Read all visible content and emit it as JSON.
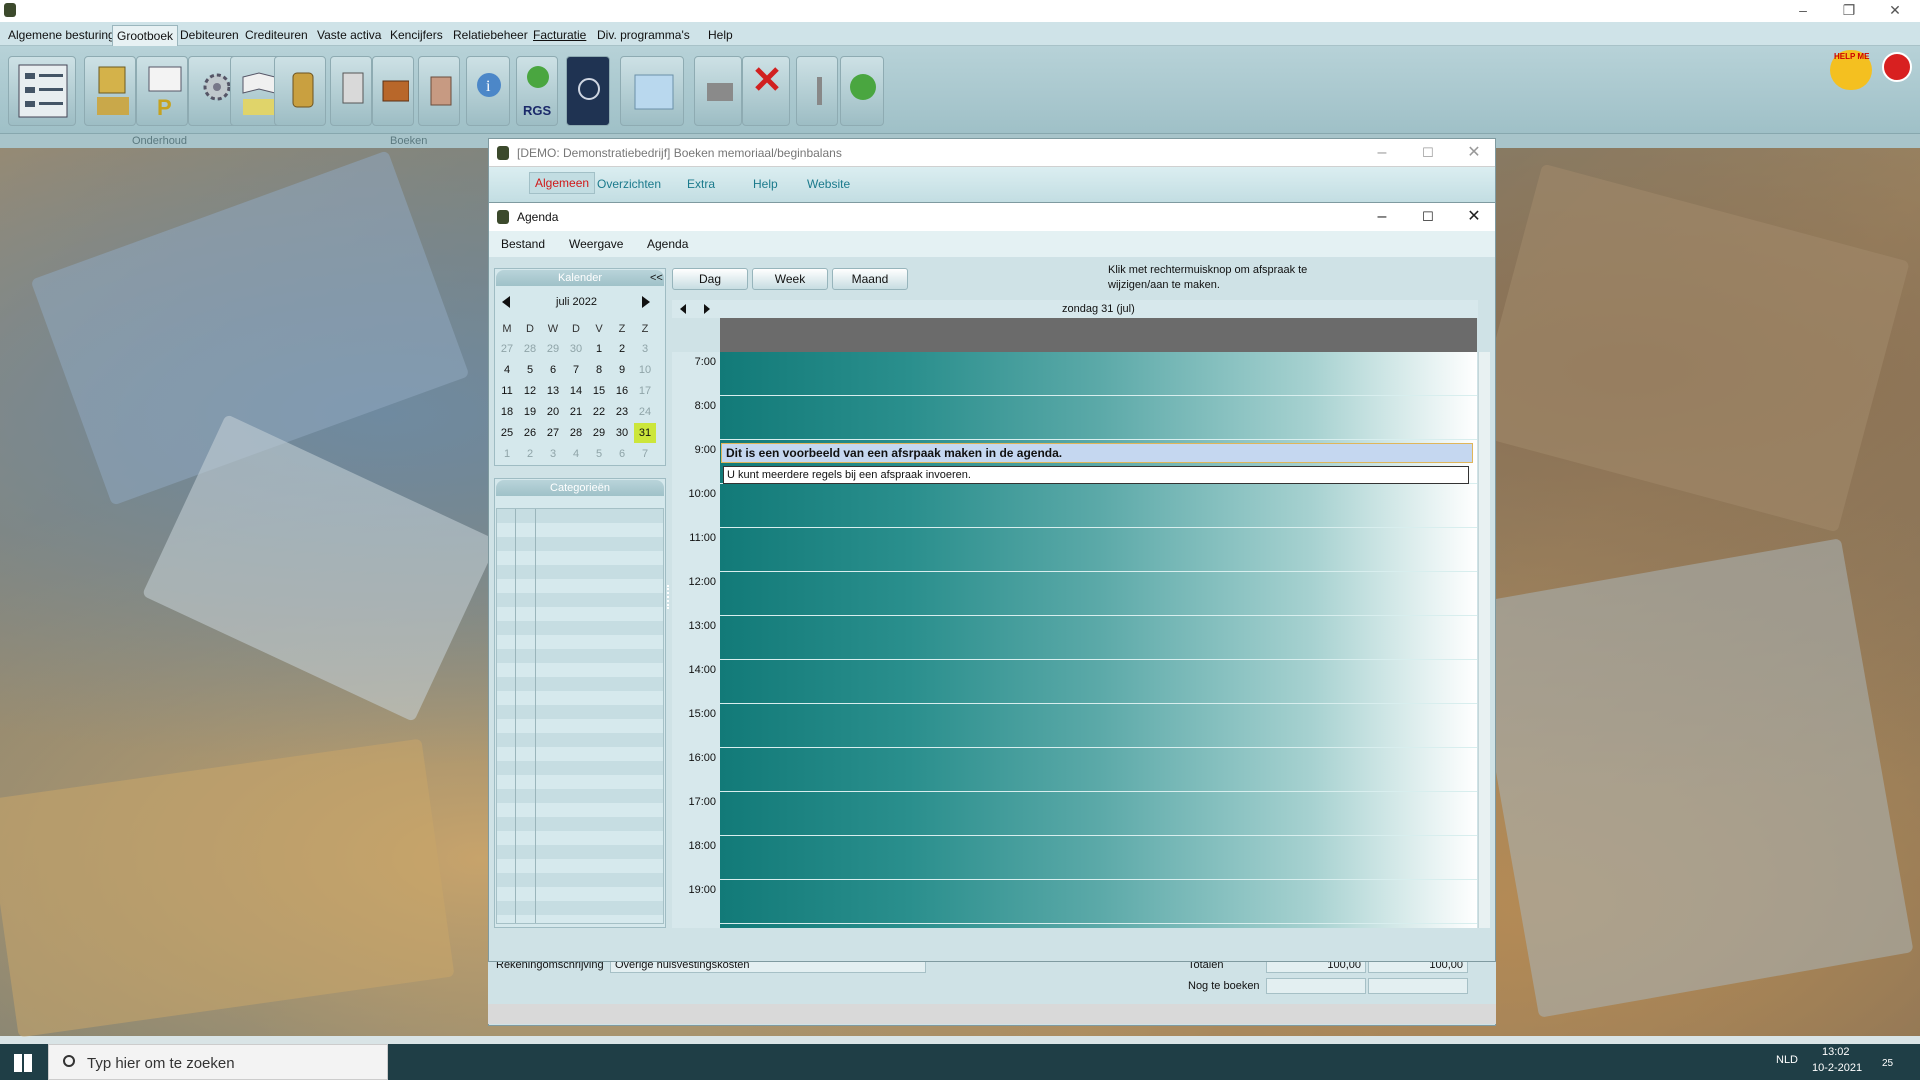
{
  "app": {
    "menu": [
      "Algemene besturing",
      "Grootboek",
      "Debiteuren",
      "Crediteuren",
      "Vaste activa",
      "Kencijfers",
      "Relatiebeheer",
      "Facturatie",
      "Div. programma's",
      "Help"
    ],
    "active_menu": "Grootboek",
    "toolbar_groups": [
      "Onderhoud",
      "Boeken"
    ],
    "rgs_label": "RGS",
    "helpme_label": "HELP ME"
  },
  "main_window": {
    "title": "[DEMO: Demonstratiebedrijf]  Boeken memoriaal/beginbalans",
    "ribbon": [
      "Algemeen",
      "Overzichten",
      "Extra",
      "Help",
      "Website"
    ],
    "active_ribbon": "Algemeen",
    "bottom": {
      "rekening_label": "Rekeningomschrijving",
      "rekening_value": "Overige huisvestingskosten",
      "totalen_label": "Totalen",
      "totalen_debet": "100,00",
      "totalen_credit": "100,00",
      "nog_label": "Nog te boeken"
    }
  },
  "agenda": {
    "title": "Agenda",
    "menu": [
      "Bestand",
      "Weergave",
      "Agenda"
    ],
    "kalender_label": "Kalender",
    "collapse_label": "<<",
    "month_label": "juli 2022",
    "weekday_headers": [
      "M",
      "D",
      "W",
      "D",
      "V",
      "Z",
      "Z"
    ],
    "weeks": [
      [
        "27",
        "28",
        "29",
        "30",
        "1",
        "2",
        "3"
      ],
      [
        "4",
        "5",
        "6",
        "7",
        "8",
        "9",
        "10"
      ],
      [
        "11",
        "12",
        "13",
        "14",
        "15",
        "16",
        "17"
      ],
      [
        "18",
        "19",
        "20",
        "21",
        "22",
        "23",
        "24"
      ],
      [
        "25",
        "26",
        "27",
        "28",
        "29",
        "30",
        "31"
      ],
      [
        "1",
        "2",
        "3",
        "4",
        "5",
        "6",
        "7"
      ]
    ],
    "selected_day": "31",
    "categorieen_label": "Categorieën",
    "view_buttons": [
      "Dag",
      "Week",
      "Maand"
    ],
    "hint": "Klik met rechtermuisknop om afspraak te wijzigen/aan te maken.",
    "day_label": "zondag 31 (jul)",
    "times": [
      "7:00",
      "8:00",
      "9:00",
      "10:00",
      "11:00",
      "12:00",
      "13:00",
      "14:00",
      "15:00",
      "16:00",
      "17:00",
      "18:00",
      "19:00"
    ],
    "appointment_title": "Dit is een voorbeeld van een afsrpaak maken in de agenda.",
    "appointment_detail": "U kunt meerdere regels bij een afspraak invoeren."
  },
  "taskbar": {
    "search_placeholder": "Typ hier om te zoeken",
    "lang": "NLD",
    "time": "13:02",
    "date": "10-2-2021",
    "notif_count": "25"
  }
}
